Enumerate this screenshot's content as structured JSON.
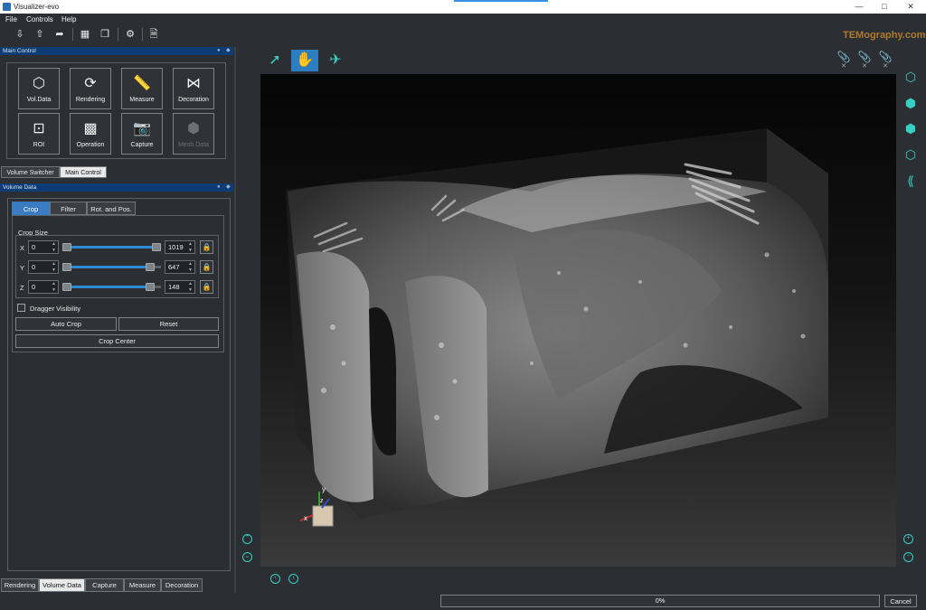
{
  "window": {
    "title": "Visualizer-evo",
    "minimize": "—",
    "maximize": "□",
    "close": "✕"
  },
  "menu": [
    "File",
    "Controls",
    "Help"
  ],
  "logo": "TEMography.com",
  "toolbar": {
    "icons": [
      "import-icon",
      "export-icon",
      "share-icon",
      "grid-icon",
      "layers-icon",
      "settings-icon",
      "document-icon"
    ]
  },
  "main_control": {
    "title": "Main Control",
    "buttons": [
      {
        "label": "Vol.Data",
        "icon": "cube-icon",
        "enabled": true
      },
      {
        "label": "Rendering",
        "icon": "render-icon",
        "enabled": true
      },
      {
        "label": "Measure",
        "icon": "ruler-icon",
        "enabled": true
      },
      {
        "label": "Decoration",
        "icon": "bow-icon",
        "enabled": true
      },
      {
        "label": "ROI",
        "icon": "roi-icon",
        "enabled": true
      },
      {
        "label": "Operation",
        "icon": "operation-icon",
        "enabled": true
      },
      {
        "label": "Capture",
        "icon": "camera-icon",
        "enabled": true
      },
      {
        "label": "Mesh Data",
        "icon": "mesh-icon",
        "enabled": false
      }
    ],
    "tabs": [
      "Volume Switcher",
      "Main Control"
    ],
    "active_tab": "Main Control"
  },
  "volume_data": {
    "title": "Volume Data",
    "tabs": [
      "Crop",
      "Filter",
      "Rot. and Pos."
    ],
    "active_tab": "Crop",
    "crop_size_label": "Crop Size",
    "axes": [
      {
        "axis": "X",
        "min": "0",
        "max": "1019",
        "max_fraction": 1.0
      },
      {
        "axis": "Y",
        "min": "0",
        "max": "647",
        "max_fraction": 0.93
      },
      {
        "axis": "Z",
        "min": "0",
        "max": "148",
        "max_fraction": 0.93
      }
    ],
    "dragger_visibility": "Dragger Visibility",
    "auto_crop": "Auto Crop",
    "reset": "Reset",
    "crop_center": "Crop Center"
  },
  "bottom_tabs": [
    "Rendering",
    "Volume Data",
    "Capture",
    "Measure",
    "Decoration"
  ],
  "active_bottom_tab": "Volume Data",
  "viewer": {
    "tools": [
      "select-arrow-icon",
      "pan-hand-icon",
      "fly-icon"
    ],
    "active_tool": "pan-hand-icon",
    "axis_labels": {
      "x": "x",
      "y": "y",
      "z": "z"
    }
  },
  "status": {
    "progress": "0%",
    "progress_fraction": 0,
    "cancel": "Cancel"
  },
  "colors": {
    "accent": "#38cfc3",
    "dock_header": "#0e3c74",
    "active_tab": "#3a7cc2",
    "slider": "#2f8ad4"
  }
}
